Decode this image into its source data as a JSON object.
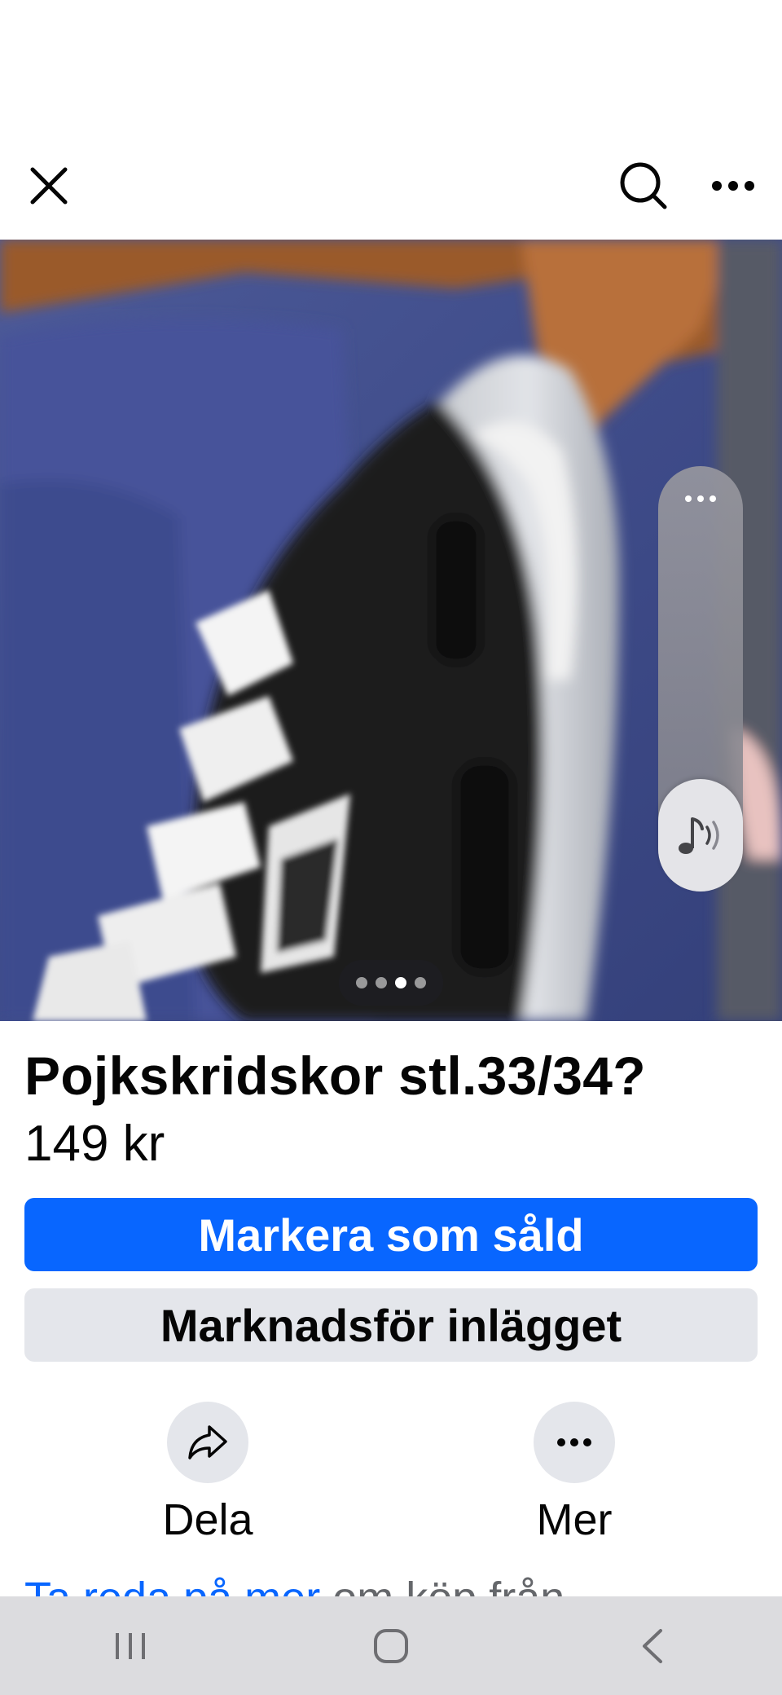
{
  "listing": {
    "title": "Pojkskridskor stl.33/34?",
    "price": "149 kr"
  },
  "gallery": {
    "image_count": 4,
    "active_index": 2
  },
  "buttons": {
    "mark_sold": "Markera som såld",
    "promote": "Marknadsför inlägget"
  },
  "actions": {
    "share_label": "Dela",
    "more_label": "Mer"
  },
  "footer": {
    "link_text": "Ta reda på mer",
    "rest_text": " om köp från"
  },
  "icons": {
    "close": "close-icon",
    "search": "search-icon",
    "more": "more-horizontal-icon",
    "share": "share-icon",
    "sound": "music-note-sound-icon"
  },
  "colors": {
    "primary": "#0866ff",
    "secondary_bg": "#e4e6eb",
    "text": "#050505",
    "nav_bg": "#dcdcdf"
  }
}
